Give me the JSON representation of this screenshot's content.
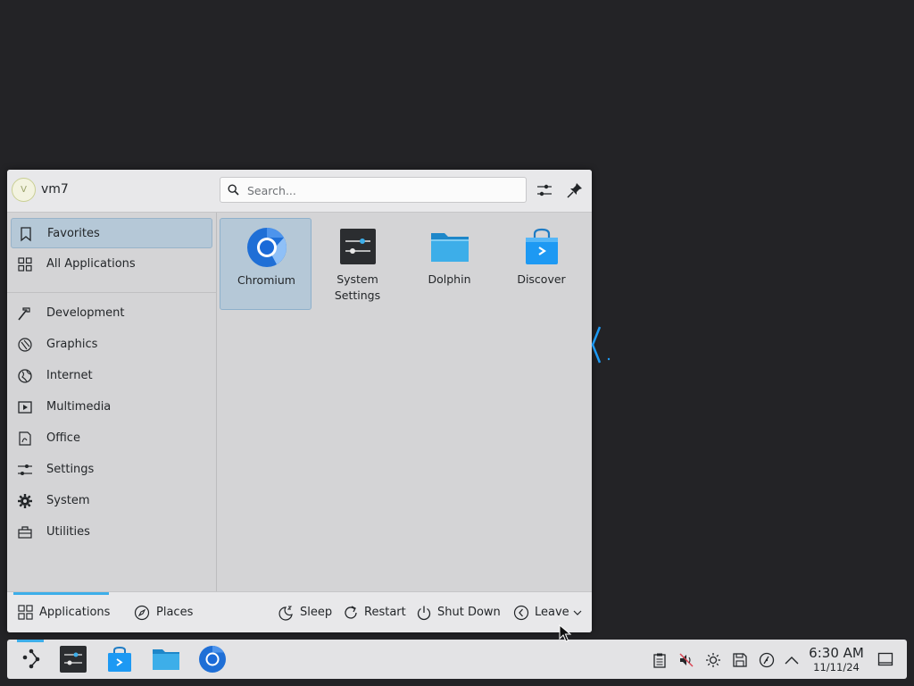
{
  "launcher": {
    "user": {
      "name": "vm7",
      "avatar_initial": "V"
    },
    "search": {
      "placeholder": "Search..."
    },
    "header_buttons": [
      {
        "icon": "configure-icon",
        "label": "Configure"
      },
      {
        "icon": "pin-icon",
        "label": "Keep open"
      }
    ],
    "sidebar": {
      "items": [
        {
          "label": "Favorites",
          "icon": "bookmark-icon",
          "active": true
        },
        {
          "label": "All Applications",
          "icon": "grid-icon"
        },
        {
          "label": "Development",
          "icon": "hammer-icon"
        },
        {
          "label": "Graphics",
          "icon": "palette-icon"
        },
        {
          "label": "Internet",
          "icon": "globe-icon"
        },
        {
          "label": "Multimedia",
          "icon": "multimedia-icon"
        },
        {
          "label": "Office",
          "icon": "document-icon"
        },
        {
          "label": "Settings",
          "icon": "sliders-icon"
        },
        {
          "label": "System",
          "icon": "gear-icon"
        },
        {
          "label": "Utilities",
          "icon": "toolbox-icon"
        }
      ]
    },
    "favorites": [
      {
        "label": "Chromium",
        "icon": "chromium-icon",
        "active": true
      },
      {
        "label": "System\nSettings",
        "icon": "system-settings-icon"
      },
      {
        "label": "Dolphin",
        "icon": "folder-icon"
      },
      {
        "label": "Discover",
        "icon": "store-bag-icon"
      }
    ],
    "footer": {
      "tabs": [
        {
          "label": "Applications",
          "icon": "grid-icon",
          "active": true
        },
        {
          "label": "Places",
          "icon": "compass-icon"
        }
      ],
      "actions": [
        {
          "label": "Sleep",
          "icon": "sleep-icon"
        },
        {
          "label": "Restart",
          "icon": "restart-icon"
        },
        {
          "label": "Shut Down",
          "icon": "power-icon"
        },
        {
          "label": "Leave",
          "icon": "leave-icon"
        }
      ]
    }
  },
  "taskbar": {
    "apps": [
      {
        "name": "Application Launcher",
        "icon": "launcher-icon",
        "active": true
      },
      {
        "name": "System Settings",
        "icon": "system-settings-icon"
      },
      {
        "name": "Discover",
        "icon": "store-bag-icon"
      },
      {
        "name": "Dolphin",
        "icon": "folder-icon"
      },
      {
        "name": "Chromium",
        "icon": "chromium-icon"
      }
    ],
    "tray": [
      "clipboard-icon",
      "volume-muted-icon",
      "brightness-icon",
      "save-icon",
      "network-icon",
      "expand-arrow-icon"
    ],
    "clock": {
      "time": "6:30 AM",
      "date": "11/11/24"
    },
    "show_desktop": "show-desktop-icon"
  },
  "colors": {
    "accent": "#3daee9",
    "selection": "#b5c8d7",
    "panel": "#e3e3e5",
    "desktop": "#232326"
  }
}
